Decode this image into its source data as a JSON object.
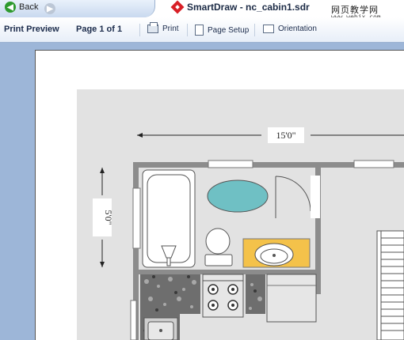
{
  "window": {
    "back_label": "Back",
    "title": "SmartDraw - nc_cabin1.sdr",
    "watermark_line1": "网页教学网",
    "watermark_line2": "www.webjx.com"
  },
  "toolbar": {
    "title": "Print Preview",
    "page_indicator": "Page 1 of 1",
    "print_label": "Print",
    "page_setup_label": "Page Setup",
    "orientation_label": "Orientation"
  },
  "plan": {
    "width_dimension": "15'0\"",
    "height_dimension": "5'0\""
  },
  "colors": {
    "accent": "#d81f26",
    "toolbar_bg": "#e7eef8",
    "viewport_bg": "#9db6d8",
    "oval_rug": "#6fc0c4",
    "vanity": "#f4c24a"
  },
  "icons": [
    "back-icon",
    "forward-icon",
    "smartdraw-icon",
    "printer-icon",
    "page-setup-icon",
    "orientation-icon"
  ]
}
